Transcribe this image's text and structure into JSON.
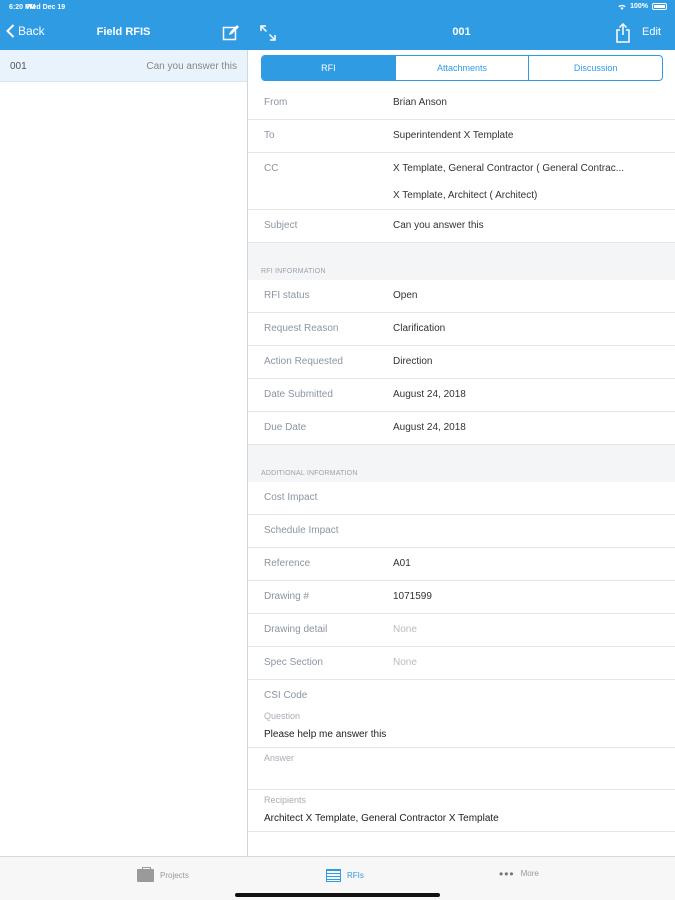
{
  "status_bar": {
    "time": "6:20 PM",
    "date": "Wed Dec 19",
    "battery": "100%"
  },
  "left_nav": {
    "back_label": "Back",
    "title": "Field RFIS"
  },
  "right_nav": {
    "title": "001",
    "edit_label": "Edit"
  },
  "rfi_list": [
    {
      "number": "001",
      "subject": "Can you answer this"
    }
  ],
  "segments": [
    "RFI",
    "Attachments",
    "Discussion"
  ],
  "details": {
    "from": {
      "label": "From",
      "value": "Brian Anson"
    },
    "to": {
      "label": "To",
      "value": "Superintendent X Template"
    },
    "cc": {
      "label": "CC",
      "value1": "X Template, General Contractor ( General Contrac...",
      "value2": "X Template, Architect ( Architect)"
    },
    "subject": {
      "label": "Subject",
      "value": "Can you answer this"
    }
  },
  "rfi_info": {
    "header": "RFI INFORMATION",
    "status": {
      "label": "RFI status",
      "value": "Open"
    },
    "reason": {
      "label": "Request Reason",
      "value": "Clarification"
    },
    "action": {
      "label": "Action Requested",
      "value": "Direction"
    },
    "submitted": {
      "label": "Date Submitted",
      "value": "August 24, 2018"
    },
    "due": {
      "label": "Due Date",
      "value": "August 24, 2018"
    }
  },
  "additional": {
    "header": "ADDITIONAL INFORMATION",
    "cost": {
      "label": "Cost Impact",
      "value": ""
    },
    "schedule": {
      "label": "Schedule Impact",
      "value": ""
    },
    "reference": {
      "label": "Reference",
      "value": "A01"
    },
    "drawing": {
      "label": "Drawing #",
      "value": "1071599"
    },
    "drawing_detail": {
      "label": "Drawing detail",
      "value": "None"
    },
    "spec": {
      "label": "Spec Section",
      "value": "None"
    },
    "csi": {
      "label": "CSI Code",
      "value": ""
    },
    "question": {
      "label": "Question",
      "value": "Please help me answer this"
    },
    "answer": {
      "label": "Answer",
      "value": ""
    },
    "recipients": {
      "label": "Recipients",
      "value": "Architect X Template, General Contractor X Template"
    }
  },
  "tabbar": {
    "projects": "Projects",
    "rfis": "RFIs",
    "more": "More"
  },
  "colors": {
    "brand": "#2f9be3"
  }
}
